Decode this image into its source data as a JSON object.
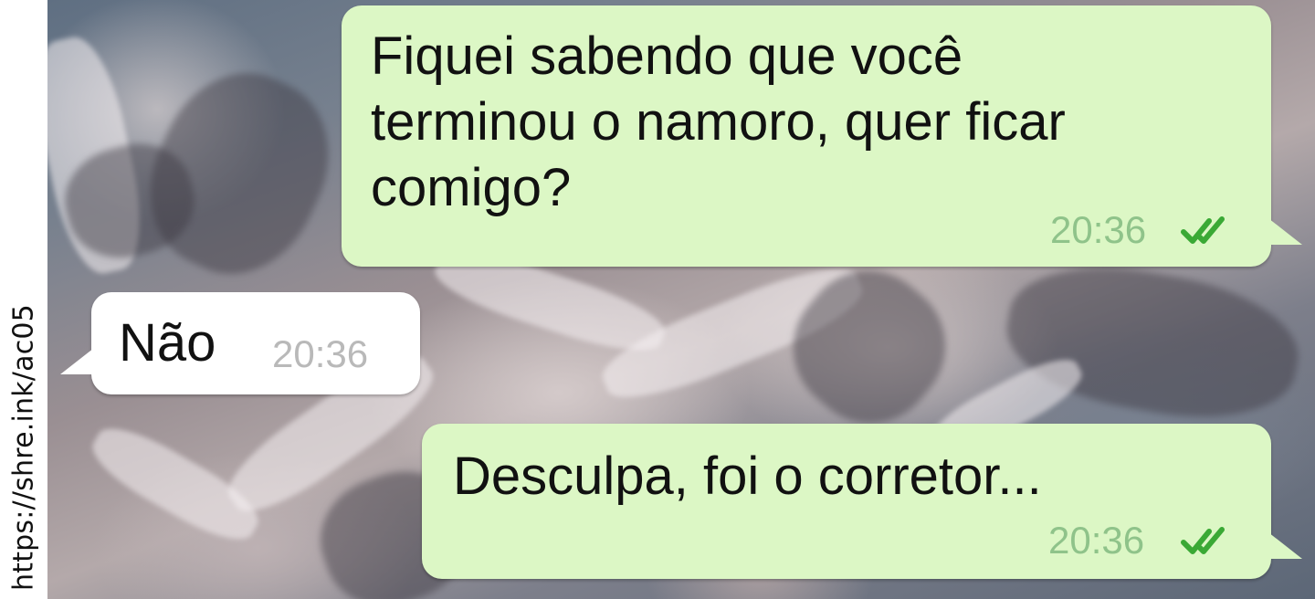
{
  "source": {
    "text": "https://shre.ink/ac05"
  },
  "colors": {
    "outgoing_bubble": "#dcf7c5",
    "incoming_bubble": "#ffffff",
    "read_ticks": "#3aa935",
    "outgoing_time": "#8fc38a",
    "incoming_time": "#b9b9b9"
  },
  "messages": [
    {
      "direction": "outgoing",
      "text": "Fiquei sabendo que você\nterminou o namoro, quer ficar\ncomigo?",
      "time": "20:36",
      "status_icon": "double-check-icon"
    },
    {
      "direction": "incoming",
      "text": "Não",
      "time": "20:36"
    },
    {
      "direction": "outgoing",
      "text": "Desculpa, foi o corretor...",
      "time": "20:36",
      "status_icon": "double-check-icon"
    }
  ]
}
